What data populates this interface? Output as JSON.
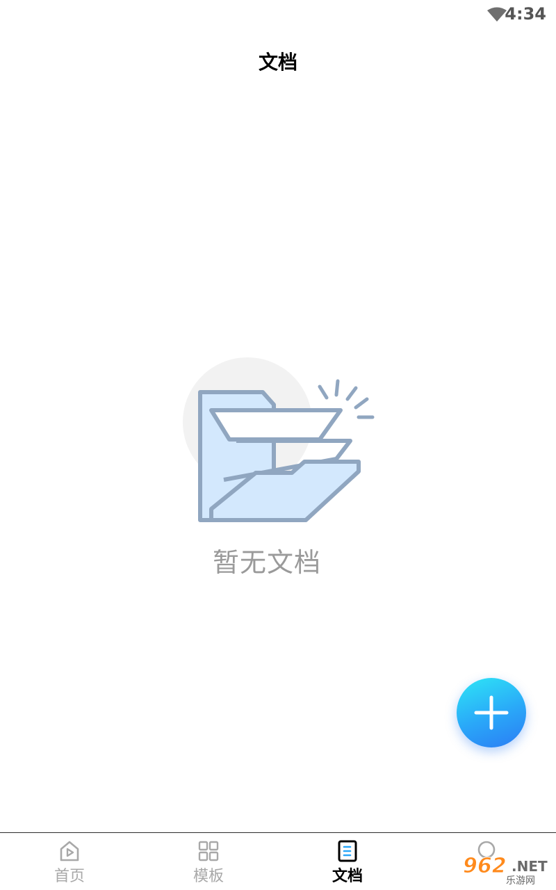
{
  "status_bar": {
    "time": "4:34",
    "wifi_icon": "wifi-icon"
  },
  "header": {
    "title": "文档"
  },
  "empty_state": {
    "message": "暂无文档",
    "illustration": "open-folder-icon"
  },
  "fab": {
    "icon": "plus-icon"
  },
  "tab_bar": {
    "tabs": [
      {
        "label": "首页",
        "icon": "home-play-icon",
        "active": false
      },
      {
        "label": "模板",
        "icon": "grid-icon",
        "active": false
      },
      {
        "label": "文档",
        "icon": "document-icon",
        "active": true
      },
      {
        "label": "",
        "icon": "profile-icon",
        "active": false
      }
    ]
  },
  "watermark": {
    "number": "962",
    "suffix": ".NET",
    "sub": "乐游网"
  },
  "colors": {
    "accent": "#2aa7f8",
    "inactive_tab": "#a8a8a8",
    "empty_text": "#9a9a9a",
    "folder_stroke": "#90a6c0",
    "folder_fill": "#d3e8fd"
  }
}
